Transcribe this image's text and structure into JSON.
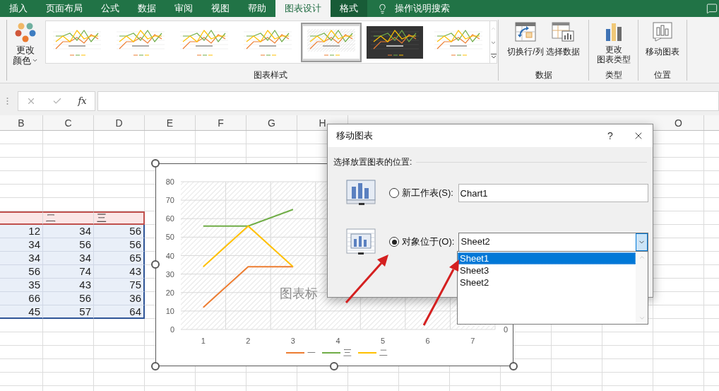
{
  "tabs": [
    {
      "label": "插入",
      "selected": false,
      "kind": "normal"
    },
    {
      "label": "页面布局",
      "selected": false,
      "kind": "normal"
    },
    {
      "label": "公式",
      "selected": false,
      "kind": "normal"
    },
    {
      "label": "数据",
      "selected": false,
      "kind": "normal"
    },
    {
      "label": "审阅",
      "selected": false,
      "kind": "normal"
    },
    {
      "label": "视图",
      "selected": false,
      "kind": "normal"
    },
    {
      "label": "帮助",
      "selected": false,
      "kind": "normal"
    },
    {
      "label": "图表设计",
      "selected": true,
      "kind": "contextual"
    },
    {
      "label": "格式",
      "selected": false,
      "kind": "contextual"
    }
  ],
  "tell_me": {
    "label": "操作说明搜索"
  },
  "ribbon": {
    "change_colors": {
      "lines": [
        "更改",
        "颜色"
      ]
    },
    "gallery": {
      "label": "图表样式",
      "styles": [
        {
          "kind": "light",
          "selected": false
        },
        {
          "kind": "light",
          "selected": false
        },
        {
          "kind": "light",
          "selected": false
        },
        {
          "kind": "light",
          "selected": false
        },
        {
          "kind": "hatched",
          "selected": true
        },
        {
          "kind": "dark",
          "selected": false
        },
        {
          "kind": "light",
          "selected": false
        }
      ]
    },
    "data_group": {
      "label": "数据",
      "buttons": [
        {
          "label": "切换行/列",
          "kind": "swap"
        },
        {
          "label": "选择数据",
          "kind": "select"
        }
      ]
    },
    "type_group": {
      "label": "类型",
      "button": {
        "lines": [
          "更改",
          "图表类型"
        ]
      }
    },
    "position_group": {
      "label": "位置",
      "button": {
        "label": "移动图表"
      }
    }
  },
  "formula_bar": {
    "function_label": "fx"
  },
  "sheet": {
    "columns": [
      "B",
      "C",
      "D",
      "E",
      "F",
      "G",
      "H",
      "O"
    ],
    "table": {
      "header": [
        "二",
        "三"
      ],
      "rows": [
        [
          "12",
          "34",
          "56"
        ],
        [
          "34",
          "56",
          "56"
        ],
        [
          "34",
          "34",
          "65"
        ],
        [
          "56",
          "74",
          "43"
        ],
        [
          "35",
          "43",
          "75"
        ],
        [
          "66",
          "56",
          "36"
        ],
        [
          "45",
          "57",
          "64"
        ]
      ]
    }
  },
  "chart": {
    "secondary_axis_label": "0",
    "chart_data": {
      "type": "line",
      "title": "图表标",
      "categories": [
        "1",
        "2",
        "3",
        "4",
        "5",
        "6",
        "7"
      ],
      "series": [
        {
          "name": "一",
          "color": "#ed7d31",
          "values": [
            12,
            34,
            34,
            null,
            null,
            null,
            null
          ]
        },
        {
          "name": "三",
          "color": "#70ad47",
          "values": [
            56,
            56,
            65,
            null,
            null,
            null,
            null
          ]
        },
        {
          "name": "二",
          "color": "#ffc000",
          "values": [
            34,
            56,
            34,
            null,
            null,
            null,
            null
          ]
        }
      ],
      "ylim": [
        0,
        80
      ],
      "yticks": [
        0,
        10,
        20,
        30,
        40,
        50,
        60,
        70,
        80
      ],
      "grid": true,
      "legend": "bottom"
    }
  },
  "dialog": {
    "title": "移动图表",
    "help": "?",
    "section_label": "选择放置图表的位置:",
    "options": [
      {
        "label": "新工作表(S):",
        "selected": false,
        "kind": "text",
        "value": "Chart1"
      },
      {
        "label": "对象位于(O):",
        "selected": true,
        "kind": "dropdown",
        "value": "Sheet2"
      }
    ],
    "dropdown_list": [
      {
        "label": "Sheet1",
        "selected": true
      },
      {
        "label": "Sheet3",
        "selected": false
      },
      {
        "label": "Sheet2",
        "selected": false
      }
    ]
  }
}
